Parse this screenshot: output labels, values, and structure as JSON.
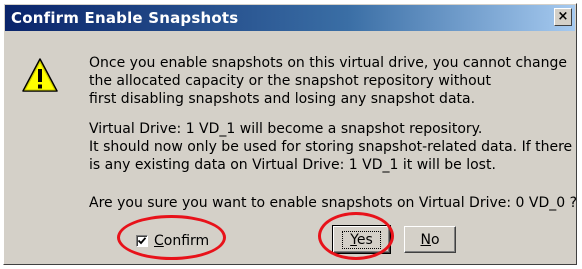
{
  "dialog": {
    "title": "Confirm Enable Snapshots",
    "close_glyph": "×",
    "icon": "warning-icon",
    "message_lines_1": [
      "Once you enable snapshots on this virtual drive, you cannot change",
      "the allocated capacity or the snapshot repository without",
      "first disabling snapshots and losing any snapshot data."
    ],
    "message_lines_2": [
      "Virtual Drive: 1 VD_1 will become a snapshot repository.",
      "It should now only be used for storing snapshot-related data. If there",
      "is any existing data on Virtual Drive: 1 VD_1 it will be lost."
    ],
    "question": "Are you sure you want to enable snapshots on Virtual Drive: 0 VD_0 ?",
    "confirm_checkbox": {
      "label_first": "C",
      "label_rest": "onfirm",
      "checked": true
    },
    "yes_button": {
      "label_first": "Y",
      "label_rest": "es"
    },
    "no_button": {
      "label_first": "N",
      "label_rest": "o"
    }
  },
  "colors": {
    "title_bar_start": "#0a246a",
    "title_bar_end": "#a6caf0",
    "dialog_face": "#d4d0c8",
    "annotation_circle": "#e8121a"
  }
}
